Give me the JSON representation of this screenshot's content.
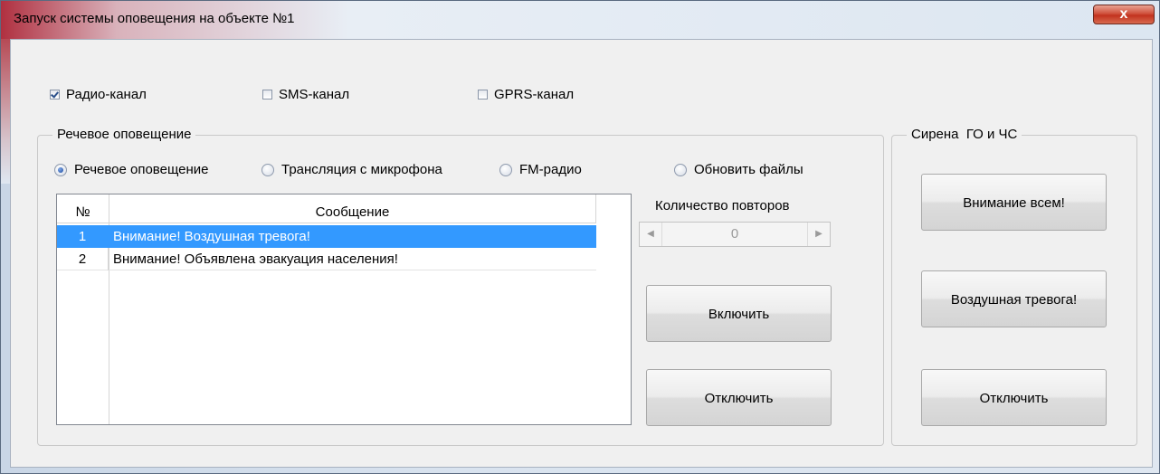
{
  "window": {
    "title": "Запуск системы оповещения на объекте №1",
    "close_glyph": "x"
  },
  "channels": [
    {
      "label": "Радио-канал",
      "checked": true
    },
    {
      "label": "SMS-канал",
      "checked": false
    },
    {
      "label": "GPRS-канал",
      "checked": false
    }
  ],
  "voice_group": {
    "title": "Речевое оповещение",
    "modes": [
      {
        "label": "Речевое оповещение",
        "selected": true
      },
      {
        "label": "Трансляция с микрофона",
        "selected": false
      },
      {
        "label": "FM-радио",
        "selected": false
      },
      {
        "label": "Обновить файлы",
        "selected": false
      }
    ],
    "table": {
      "columns": [
        "№",
        "Сообщение"
      ],
      "rows": [
        {
          "num": "1",
          "message": "Внимание! Воздушная тревога!",
          "selected": true
        },
        {
          "num": "2",
          "message": "Внимание! Объявлена эвакуация населения!",
          "selected": false
        }
      ]
    },
    "repeat_label": "Количество повторов",
    "repeat_value": "0",
    "on_button": "Включить",
    "off_button": "Отключить"
  },
  "siren_group": {
    "title": "Сирена  ГО и ЧС",
    "attention_button": "Внимание всем!",
    "air_raid_button": "Воздушная тревога!",
    "off_button": "Отключить"
  },
  "colors": {
    "selection": "#3399ff",
    "close_button": "#c2321e"
  }
}
